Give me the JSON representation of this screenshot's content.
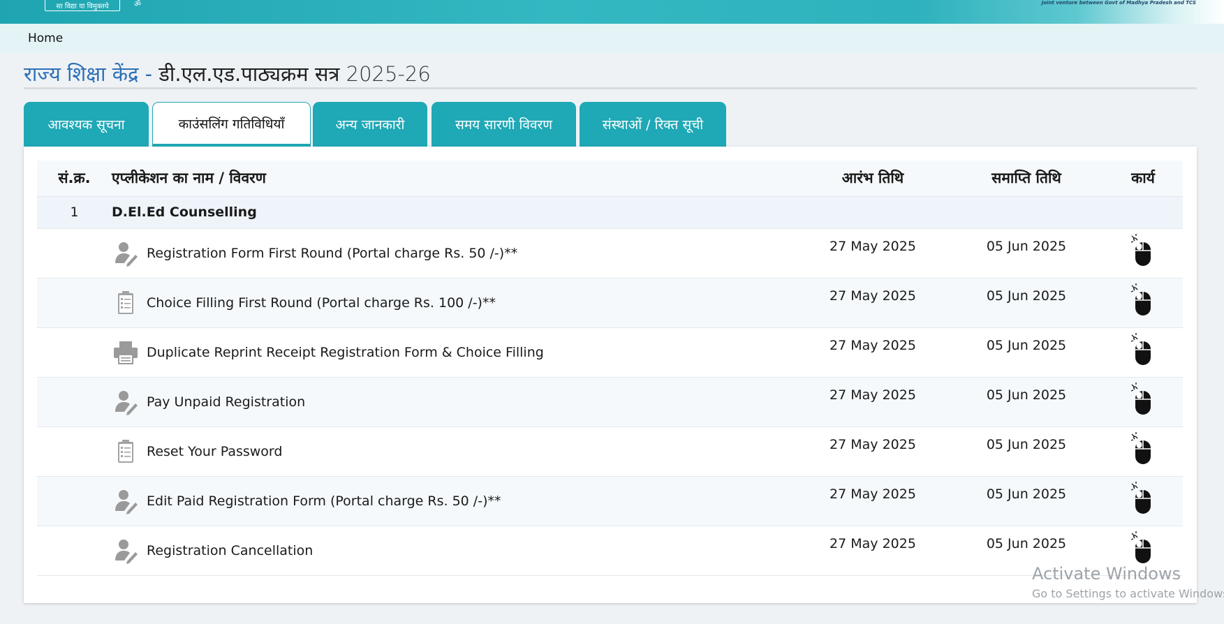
{
  "header": {
    "logo_text": "सा विद्या या विमुक्तये",
    "logo_mark": "ॐ",
    "partner_text": "Joint venture between Govt of Madhya Pradesh and TCS"
  },
  "breadcrumb": {
    "home": "Home"
  },
  "title": {
    "org": "राज्य शिक्षा केंद्र -",
    "course": "डी.एल.एड.पाठ्यक्रम सत्र",
    "session": "2025-26"
  },
  "tabs": [
    {
      "label": "आवश्यक सूचना",
      "active": false
    },
    {
      "label": "काउंसलिंग गतिविधियाँ",
      "active": true
    },
    {
      "label": "अन्य जानकारी",
      "active": false
    },
    {
      "label": "समय सारणी विवरण",
      "active": false
    },
    {
      "label": "संस्थाओं / रिक्त सूची",
      "active": false
    }
  ],
  "table": {
    "headers": {
      "no": "सं.क्र.",
      "name": "एप्लीकेशन का नाम / विवरण",
      "start": "आरंभ तिथि",
      "end": "समाप्ति तिथि",
      "action": "कार्य"
    },
    "group": {
      "no": "1",
      "name": "D.El.Ed Counselling"
    },
    "rows": [
      {
        "icon": "user-edit-icon",
        "name": "Registration Form First Round (Portal charge Rs. 50 /-)**",
        "start": "27 May 2025",
        "end": "05 Jun 2025"
      },
      {
        "icon": "clipboard-checklist-icon",
        "name": "Choice Filling First Round (Portal charge Rs. 100 /-)**",
        "start": "27 May 2025",
        "end": "05 Jun 2025"
      },
      {
        "icon": "printer-icon",
        "name": "Duplicate Reprint Receipt Registration Form & Choice Filling",
        "start": "27 May 2025",
        "end": "05 Jun 2025"
      },
      {
        "icon": "user-edit-icon",
        "name": "Pay Unpaid Registration",
        "start": "27 May 2025",
        "end": "05 Jun 2025"
      },
      {
        "icon": "clipboard-checklist-icon",
        "name": "Reset Your Password",
        "start": "27 May 2025",
        "end": "05 Jun 2025"
      },
      {
        "icon": "user-edit-icon",
        "name": "Edit Paid Registration Form (Portal charge Rs. 50 /-)**",
        "start": "27 May 2025",
        "end": "05 Jun 2025"
      },
      {
        "icon": "user-edit-icon",
        "name": "Registration Cancellation",
        "start": "27 May 2025",
        "end": "05 Jun 2025"
      }
    ]
  },
  "watermark": {
    "title": "Activate Windows",
    "subtitle": "Go to Settings to activate Windows."
  },
  "colors": {
    "accent_teal": "#1fa8b6",
    "title_blue": "#2e6fb5",
    "breadcrumb_bg": "#e4f3f6"
  }
}
